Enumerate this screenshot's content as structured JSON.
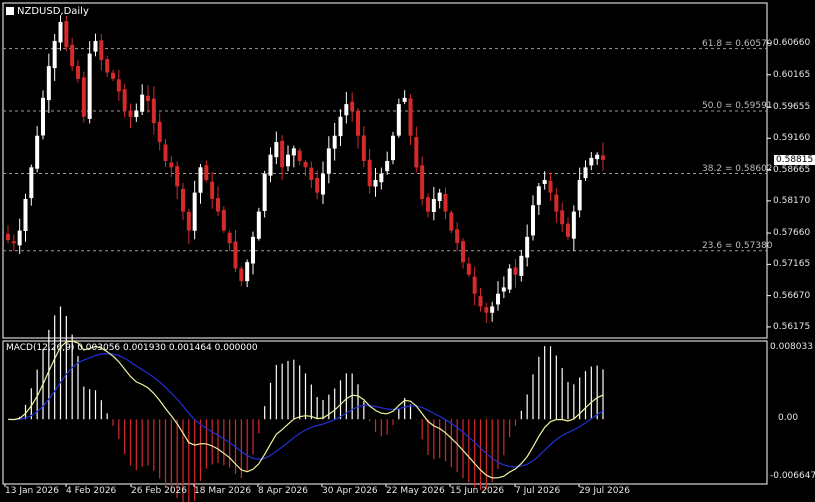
{
  "main": {
    "symbol_label": "NZDUSD,Daily",
    "price_min": 0.56,
    "price_max": 0.613,
    "price_ticks": [
      "0.60660",
      "0.60165",
      "0.59655",
      "0.59160",
      "0.58665",
      "0.58170",
      "0.57660",
      "0.57165",
      "0.56670",
      "0.56175"
    ],
    "current_price": "0.58815",
    "fib_levels": [
      {
        "label": "61.8 = 0.60579",
        "price": 0.60579
      },
      {
        "label": "50.0 = 0.59591",
        "price": 0.59591
      },
      {
        "label": "38.2 = 0.58602",
        "price": 0.58602
      },
      {
        "label": "23.6 = 0.57380",
        "price": 0.5738
      }
    ]
  },
  "macd": {
    "label": "MACD(12,26,9) 0.003056 0.001930 0.001464 0.000000",
    "max_tick": "0.008033",
    "zero_tick": "0.00",
    "min_tick": "-0.006647"
  },
  "time_axis": {
    "labels": [
      "13 Jan 2026",
      "4 Feb 2026",
      "26 Feb 2026",
      "18 Mar 2026",
      "8 Apr 2026",
      "30 Apr 2026",
      "22 May 2026",
      "15 Jun 2026",
      "7 Jul 2026",
      "29 Jul 2026"
    ]
  },
  "colors": {
    "background": "#000000",
    "bull_candle": "#ffffff",
    "bear_candle": "#d42a2a",
    "macd_signal": "#1f2fd8",
    "macd_line": "#f2f2a0",
    "grid_dash": "#9a9a9a"
  },
  "chart_data": {
    "type": "candlestick",
    "bar_timeframe": "Daily",
    "close_path": [
      0.5755,
      0.575,
      0.577,
      0.582,
      0.587,
      0.592,
      0.598,
      0.603,
      0.607,
      0.61,
      0.606,
      0.603,
      0.601,
      0.595,
      0.605,
      0.607,
      0.604,
      0.602,
      0.601,
      0.599,
      0.596,
      0.595,
      0.596,
      0.5985,
      0.5975,
      0.594,
      0.591,
      0.588,
      0.587,
      0.584,
      0.58,
      0.577,
      0.583,
      0.587,
      0.585,
      0.582,
      0.58,
      0.577,
      0.575,
      0.571,
      0.569,
      0.572,
      0.576,
      0.58,
      0.586,
      0.589,
      0.591,
      0.587,
      0.589,
      0.59,
      0.588,
      0.587,
      0.585,
      0.583,
      0.586,
      0.59,
      0.592,
      0.595,
      0.597,
      0.596,
      0.592,
      0.588,
      0.584,
      0.585,
      0.586,
      0.588,
      0.592,
      0.597,
      0.598,
      0.592,
      0.587,
      0.582,
      0.58,
      0.582,
      0.583,
      0.58,
      0.577,
      0.575,
      0.572,
      0.57,
      0.567,
      0.565,
      0.564,
      0.565,
      0.567,
      0.568,
      0.571,
      0.57,
      0.573,
      0.576,
      0.581,
      0.584,
      0.585,
      0.583,
      0.58,
      0.578,
      0.576,
      0.58,
      0.585,
      0.587,
      0.5885,
      0.589,
      0.5882
    ]
  }
}
